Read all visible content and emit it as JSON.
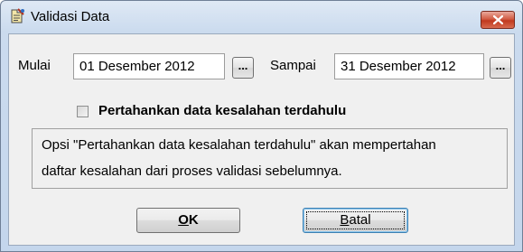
{
  "window": {
    "title": "Validasi Data",
    "title_icon": "validate-data-icon",
    "close_icon": "close-icon"
  },
  "period": {
    "start_label": "Mulai",
    "start_value": "01 Desember 2012",
    "end_label": "Sampai",
    "end_value": "31 Desember 2012",
    "picker_label": "..."
  },
  "options": {
    "keep_errors_label": "Pertahankan data kesalahan terdahulu",
    "keep_errors_checked": false
  },
  "info": {
    "line1": "Opsi \"Pertahankan data kesalahan terdahulu\" akan mempertahan",
    "line2": "daftar kesalahan dari proses validasi sebelumnya."
  },
  "buttons": {
    "ok_mnemonic": "O",
    "ok_rest": "K",
    "cancel_mnemonic": "B",
    "cancel_rest": "atal"
  },
  "colors": {
    "close_button": "#c0391f",
    "title_bar": "#cbdbee",
    "client_bg": "#f0f0f0"
  }
}
